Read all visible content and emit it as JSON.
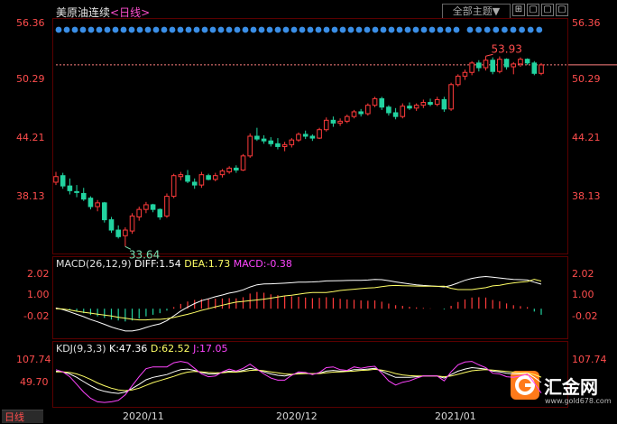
{
  "header": {
    "instrument": "美原油连续",
    "period": "<日线>",
    "theme_button": "全部主题▼",
    "win_buttons": [
      "⊞",
      "▢",
      "▢",
      "▢"
    ]
  },
  "colors": {
    "up": "#ff3b3b",
    "down": "#22d3a0",
    "ma_dash": "#ff8080",
    "diff": "#ffffff",
    "dea": "#ffff66",
    "j": "#ff44ff",
    "dots": "#3a8ee6"
  },
  "main_axis": {
    "left_labels": [
      "56.36",
      "50.29",
      "44.21",
      "38.13"
    ],
    "right_labels": [
      "56.36",
      "50.29",
      "44.21",
      "38.13"
    ],
    "ylim": [
      33.0,
      57.8
    ],
    "current_price": 53.0,
    "high_label": "53.93",
    "low_label": "33.64"
  },
  "x_axis": {
    "labels": [
      "2020/11",
      "2020/12",
      "2021/01"
    ],
    "label_index": [
      13,
      34,
      55
    ]
  },
  "macd": {
    "legend": {
      "name": "MACD(26,12,9)",
      "diff": "DIFF:1.54",
      "dea": "DEA:1.73",
      "macd": "MACD:-0.38"
    },
    "left_labels": [
      "2.02",
      "1.00",
      "-0.02"
    ],
    "right_labels": [
      "2.02",
      "1.00",
      "-0.02"
    ],
    "ylim": [
      -1.8,
      2.5
    ]
  },
  "kdj": {
    "legend": {
      "name": "KDJ(9,3,3)",
      "k": "K:47.36",
      "d": "D:62.52",
      "j": "J:17.05"
    },
    "left_labels": [
      "107.74",
      "49.70"
    ],
    "right_labels": [
      "107.74"
    ],
    "ylim": [
      -20,
      125
    ]
  },
  "badge": "日线",
  "logo": {
    "name": "汇金网",
    "url": "www.gold678.com"
  },
  "chart_data": {
    "type": "candlestick",
    "candles": [
      [
        40.5,
        41.6,
        40.2,
        41.1
      ],
      [
        41.2,
        41.5,
        39.8,
        40.1
      ],
      [
        40.1,
        40.9,
        39.2,
        39.6
      ],
      [
        39.5,
        40.2,
        38.9,
        39.4
      ],
      [
        39.3,
        39.9,
        38.5,
        38.7
      ],
      [
        38.8,
        39.0,
        37.6,
        37.9
      ],
      [
        37.9,
        38.6,
        37.4,
        38.3
      ],
      [
        38.3,
        38.4,
        36.2,
        36.5
      ],
      [
        36.5,
        36.8,
        35.1,
        35.4
      ],
      [
        35.4,
        35.9,
        34.5,
        34.7
      ],
      [
        34.8,
        35.7,
        33.64,
        35.4
      ],
      [
        35.3,
        37.2,
        35.0,
        36.9
      ],
      [
        36.8,
        37.9,
        36.4,
        37.6
      ],
      [
        37.6,
        38.4,
        37.2,
        38.1
      ],
      [
        38.1,
        38.2,
        37.3,
        37.6
      ],
      [
        37.6,
        37.7,
        36.5,
        36.8
      ],
      [
        36.9,
        39.3,
        36.7,
        39.0
      ],
      [
        39.0,
        41.4,
        38.8,
        41.2
      ],
      [
        41.1,
        41.6,
        40.7,
        41.3
      ],
      [
        41.2,
        41.8,
        40.4,
        40.6
      ],
      [
        40.5,
        40.9,
        39.8,
        40.2
      ],
      [
        40.2,
        41.6,
        39.9,
        41.3
      ],
      [
        41.2,
        41.4,
        40.7,
        40.8
      ],
      [
        40.8,
        41.5,
        40.6,
        41.2
      ],
      [
        41.3,
        41.9,
        41.0,
        41.7
      ],
      [
        41.6,
        42.2,
        41.4,
        42.0
      ],
      [
        42.0,
        42.3,
        41.5,
        41.8
      ],
      [
        41.8,
        43.5,
        41.7,
        43.3
      ],
      [
        43.3,
        45.7,
        43.1,
        45.4
      ],
      [
        45.4,
        46.3,
        44.9,
        45.1
      ],
      [
        45.1,
        45.5,
        44.6,
        44.9
      ],
      [
        44.9,
        45.3,
        44.3,
        44.6
      ],
      [
        44.6,
        45.2,
        44.0,
        44.3
      ],
      [
        44.3,
        44.8,
        43.8,
        44.5
      ],
      [
        44.5,
        45.2,
        44.2,
        45.0
      ],
      [
        45.0,
        45.8,
        44.8,
        45.6
      ],
      [
        45.6,
        46.0,
        45.1,
        45.4
      ],
      [
        45.4,
        45.6,
        44.9,
        45.2
      ],
      [
        45.2,
        46.3,
        45.1,
        46.1
      ],
      [
        46.1,
        47.4,
        45.9,
        47.1
      ],
      [
        47.1,
        47.5,
        46.4,
        46.8
      ],
      [
        46.8,
        47.3,
        46.5,
        47.0
      ],
      [
        47.0,
        47.7,
        46.8,
        47.5
      ],
      [
        47.5,
        48.2,
        47.3,
        48.0
      ],
      [
        48.0,
        48.3,
        47.5,
        47.8
      ],
      [
        47.8,
        48.9,
        47.6,
        48.7
      ],
      [
        48.7,
        49.6,
        48.5,
        49.4
      ],
      [
        49.4,
        49.6,
        48.2,
        48.5
      ],
      [
        48.5,
        48.7,
        47.6,
        47.9
      ],
      [
        47.9,
        48.4,
        47.2,
        47.5
      ],
      [
        47.5,
        48.9,
        47.3,
        48.6
      ],
      [
        48.6,
        49.0,
        48.2,
        48.4
      ],
      [
        48.4,
        48.9,
        48.1,
        48.7
      ],
      [
        48.7,
        49.3,
        48.4,
        49.0
      ],
      [
        49.0,
        49.4,
        48.6,
        48.8
      ],
      [
        48.8,
        49.6,
        48.6,
        49.3
      ],
      [
        49.3,
        49.6,
        48.0,
        48.3
      ],
      [
        48.3,
        51.1,
        48.1,
        50.9
      ],
      [
        50.9,
        52.0,
        50.7,
        51.8
      ],
      [
        51.8,
        52.5,
        51.4,
        52.2
      ],
      [
        52.2,
        53.4,
        51.9,
        53.2
      ],
      [
        53.2,
        53.5,
        52.3,
        52.7
      ],
      [
        52.7,
        53.93,
        52.4,
        53.5
      ],
      [
        53.5,
        53.8,
        52.0,
        52.3
      ],
      [
        52.3,
        53.9,
        52.1,
        53.6
      ],
      [
        53.6,
        53.7,
        52.5,
        52.8
      ],
      [
        52.8,
        53.3,
        52.0,
        53.1
      ],
      [
        53.1,
        53.8,
        52.8,
        53.6
      ],
      [
        53.6,
        53.7,
        53.0,
        53.2
      ],
      [
        53.2,
        53.4,
        51.9,
        52.1
      ],
      [
        52.1,
        53.2,
        51.9,
        53.0
      ]
    ],
    "markers": {
      "high": 53.93,
      "low": 33.64
    },
    "macd": {
      "hist": [
        0.05,
        0.0,
        -0.1,
        -0.18,
        -0.28,
        -0.4,
        -0.48,
        -0.58,
        -0.68,
        -0.74,
        -0.8,
        -0.74,
        -0.62,
        -0.48,
        -0.38,
        -0.28,
        -0.12,
        0.1,
        0.3,
        0.45,
        0.55,
        0.6,
        0.62,
        0.63,
        0.64,
        0.66,
        0.65,
        0.72,
        0.95,
        1.05,
        1.0,
        0.9,
        0.85,
        0.8,
        0.78,
        0.75,
        0.7,
        0.66,
        0.68,
        0.72,
        0.68,
        0.62,
        0.58,
        0.56,
        0.52,
        0.5,
        0.52,
        0.44,
        0.32,
        0.22,
        0.18,
        0.12,
        0.08,
        0.05,
        0.02,
        0.0,
        -0.05,
        0.18,
        0.42,
        0.58,
        0.7,
        0.72,
        0.7,
        0.55,
        0.46,
        0.33,
        0.22,
        0.16,
        0.1,
        -0.18,
        -0.38
      ],
      "diff": [
        0.05,
        -0.05,
        -0.2,
        -0.35,
        -0.5,
        -0.68,
        -0.82,
        -0.98,
        -1.15,
        -1.28,
        -1.4,
        -1.4,
        -1.32,
        -1.18,
        -1.05,
        -0.95,
        -0.75,
        -0.45,
        -0.15,
        0.1,
        0.32,
        0.5,
        0.62,
        0.75,
        0.86,
        0.98,
        1.06,
        1.18,
        1.36,
        1.5,
        1.55,
        1.56,
        1.58,
        1.6,
        1.63,
        1.66,
        1.67,
        1.68,
        1.7,
        1.74,
        1.75,
        1.76,
        1.77,
        1.78,
        1.78,
        1.8,
        1.84,
        1.82,
        1.76,
        1.68,
        1.62,
        1.55,
        1.5,
        1.46,
        1.43,
        1.4,
        1.36,
        1.46,
        1.62,
        1.78,
        1.9,
        1.98,
        2.02,
        1.98,
        1.93,
        1.88,
        1.84,
        1.82,
        1.8,
        1.66,
        1.54
      ],
      "dea": [
        0.0,
        -0.02,
        -0.08,
        -0.16,
        -0.22,
        -0.28,
        -0.34,
        -0.4,
        -0.46,
        -0.54,
        -0.6,
        -0.66,
        -0.7,
        -0.7,
        -0.67,
        -0.67,
        -0.63,
        -0.55,
        -0.45,
        -0.35,
        -0.23,
        -0.1,
        0.0,
        0.12,
        0.22,
        0.32,
        0.41,
        0.46,
        0.51,
        0.55,
        0.6,
        0.66,
        0.73,
        0.8,
        0.85,
        0.91,
        0.97,
        1.02,
        1.02,
        1.02,
        1.07,
        1.14,
        1.19,
        1.22,
        1.26,
        1.3,
        1.32,
        1.38,
        1.44,
        1.46,
        1.44,
        1.43,
        1.42,
        1.41,
        1.41,
        1.4,
        1.41,
        1.28,
        1.2,
        1.2,
        1.2,
        1.26,
        1.32,
        1.43,
        1.47,
        1.55,
        1.62,
        1.66,
        1.7,
        1.84,
        1.73
      ]
    },
    "kdj": {
      "k": [
        80,
        78,
        72,
        62,
        50,
        38,
        28,
        22,
        18,
        16,
        20,
        30,
        42,
        55,
        62,
        66,
        70,
        78,
        84,
        86,
        82,
        76,
        72,
        72,
        76,
        80,
        78,
        82,
        88,
        84,
        78,
        72,
        68,
        66,
        70,
        74,
        74,
        72,
        74,
        80,
        82,
        80,
        80,
        84,
        84,
        86,
        88,
        80,
        70,
        62,
        62,
        62,
        64,
        66,
        66,
        66,
        60,
        70,
        80,
        86,
        90,
        88,
        86,
        80,
        78,
        74,
        72,
        72,
        74,
        62,
        47.36
      ],
      "d": [
        78,
        78,
        76,
        72,
        65,
        56,
        46,
        38,
        31,
        26,
        24,
        26,
        31,
        39,
        47,
        53,
        59,
        65,
        72,
        77,
        79,
        78,
        76,
        75,
        75,
        77,
        77,
        79,
        82,
        83,
        81,
        78,
        75,
        72,
        71,
        72,
        73,
        73,
        73,
        75,
        77,
        78,
        79,
        80,
        82,
        83,
        85,
        83,
        79,
        73,
        69,
        67,
        66,
        66,
        66,
        66,
        64,
        66,
        71,
        76,
        81,
        83,
        84,
        83,
        81,
        79,
        77,
        75,
        75,
        70,
        62.52
      ],
      "j": [
        84,
        78,
        64,
        42,
        20,
        2,
        -8,
        -10,
        -8,
        -4,
        12,
        38,
        64,
        87,
        92,
        92,
        92,
        104,
        108,
        104,
        88,
        72,
        64,
        66,
        78,
        86,
        80,
        88,
        100,
        86,
        72,
        60,
        54,
        54,
        68,
        78,
        76,
        70,
        76,
        90,
        92,
        84,
        82,
        92,
        88,
        92,
        94,
        74,
        52,
        40,
        48,
        52,
        60,
        66,
        66,
        66,
        52,
        78,
        98,
        106,
        108,
        98,
        90,
        74,
        72,
        64,
        62,
        66,
        72,
        46,
        17.05
      ]
    }
  }
}
